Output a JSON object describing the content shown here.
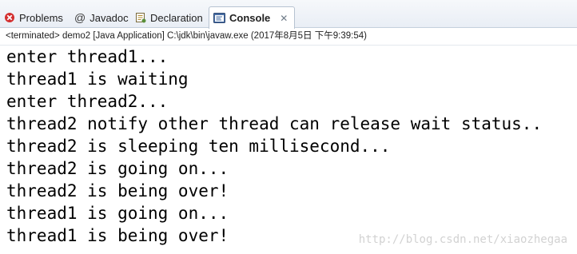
{
  "tabs": [
    {
      "label": "Problems",
      "icon": "problems-icon"
    },
    {
      "label": "Javadoc",
      "icon": "javadoc-icon"
    },
    {
      "label": "Declaration",
      "icon": "declaration-icon"
    },
    {
      "label": "Console",
      "icon": "console-icon",
      "active": true,
      "close": "✕"
    }
  ],
  "status_line": "<terminated> demo2 [Java Application] C:\\jdk\\bin\\javaw.exe (2017年8月5日 下午9:39:54)",
  "console_lines": [
    "enter thread1...",
    "thread1 is waiting",
    "enter thread2...",
    "thread2 notify other thread can release wait status..",
    "thread2 is sleeping ten millisecond...",
    "thread2 is going on...",
    "thread2 is being over!",
    "thread1 is going on...",
    "thread1 is being over!"
  ],
  "watermark": "http://blog.csdn.net/xiaozhegaa",
  "colors": {
    "tab_bar": "#e9eef5",
    "problems_icon": "#d32f2f",
    "console_icon": "#4a6fa5"
  }
}
